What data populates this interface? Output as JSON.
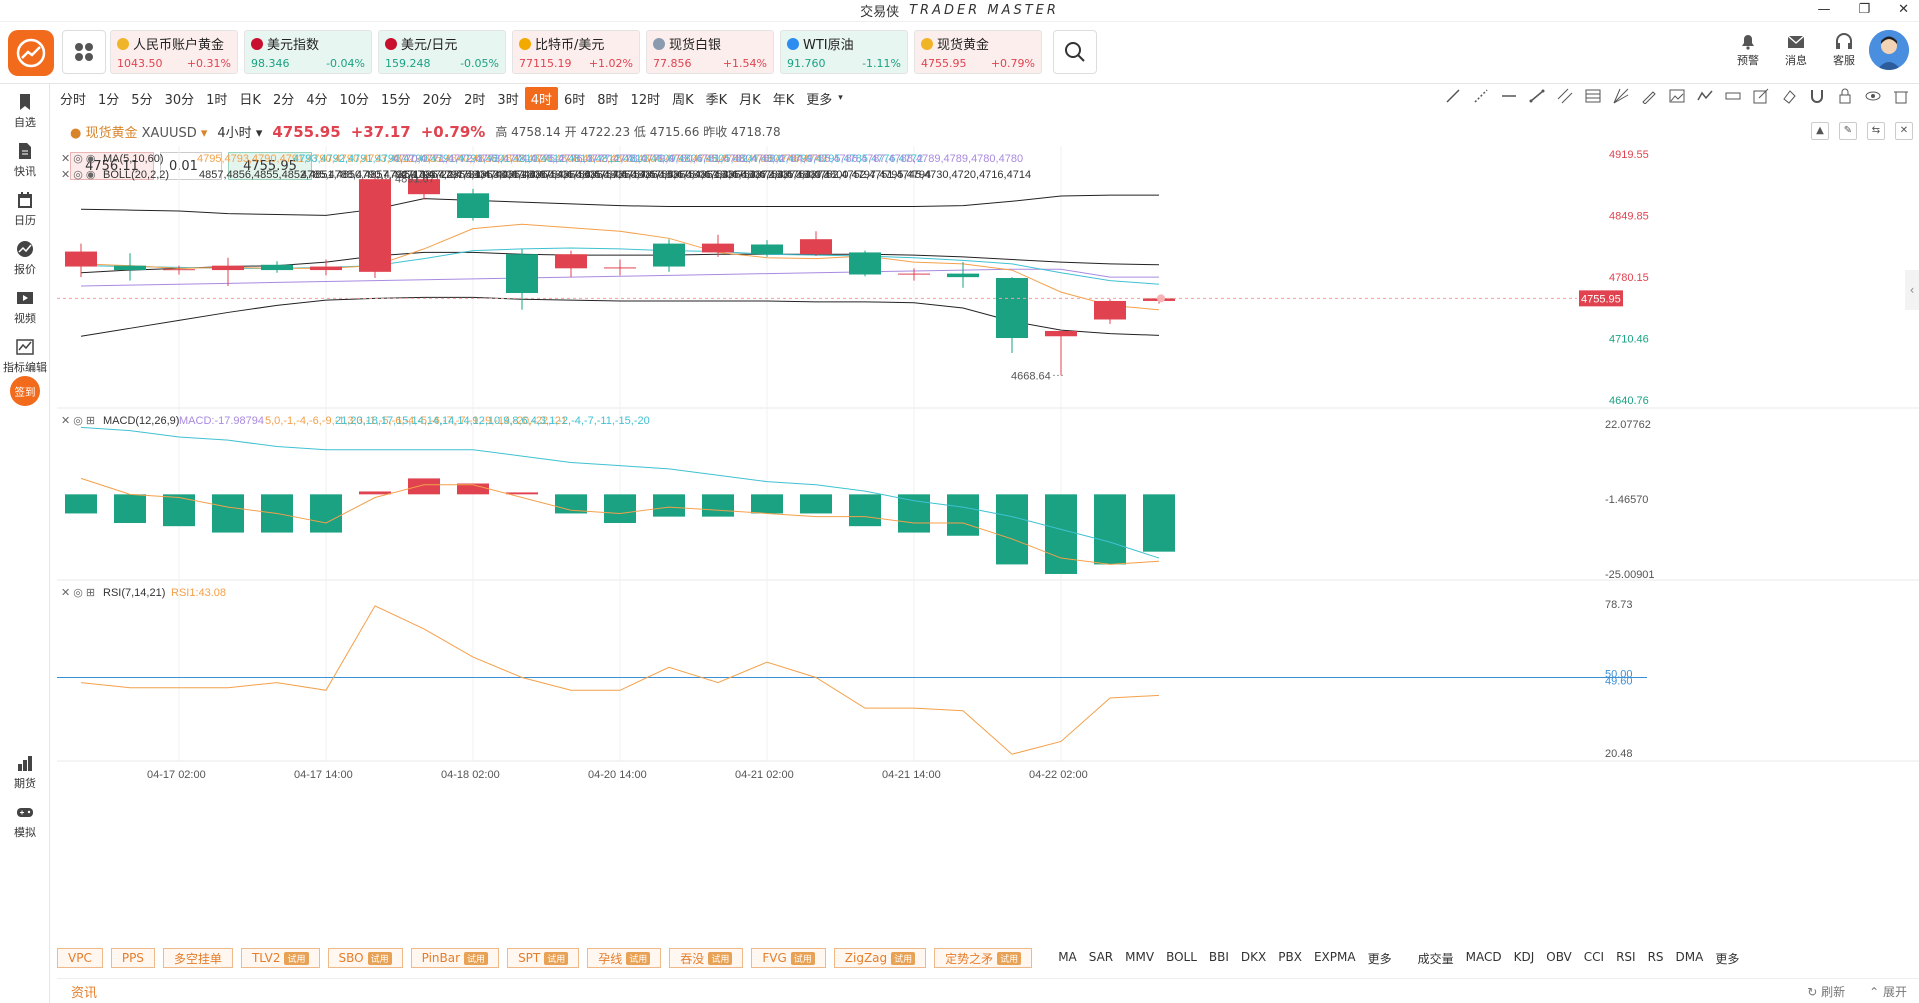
{
  "window": {
    "title_cn": "交易侠",
    "title_en": "TRADER MASTER"
  },
  "tickers": [
    {
      "name": "人民币账户黄金",
      "price": "1043.50",
      "change": "+0.31%",
      "dir": "up",
      "dot": "#f0b429"
    },
    {
      "name": "美元指数",
      "price": "98.346",
      "change": "-0.04%",
      "dir": "down",
      "dot": "#c8102e"
    },
    {
      "name": "美元/日元",
      "price": "159.248",
      "change": "-0.05%",
      "dir": "down",
      "dot": "#c8102e"
    },
    {
      "name": "比特币/美元",
      "price": "77115.19",
      "change": "+1.02%",
      "dir": "up",
      "dot": "#f2a900"
    },
    {
      "name": "现货白银",
      "price": "77.856",
      "change": "+1.54%",
      "dir": "up",
      "dot": "#8a9bb0"
    },
    {
      "name": "WTI原油",
      "price": "91.760",
      "change": "-1.11%",
      "dir": "down",
      "dot": "#2d8cf0"
    },
    {
      "name": "现货黄金",
      "price": "4755.95",
      "change": "+0.79%",
      "dir": "up",
      "dot": "#f0b429"
    }
  ],
  "header_actions": [
    {
      "name": "alert",
      "label": "预警",
      "icon": "bell-icon"
    },
    {
      "name": "message",
      "label": "消息",
      "icon": "mail-icon"
    },
    {
      "name": "service",
      "label": "客服",
      "icon": "headset-icon"
    }
  ],
  "sidebar": [
    {
      "name": "watchlist",
      "label": "自选",
      "icon": "bookmark-icon",
      "top": 0
    },
    {
      "name": "news",
      "label": "快讯",
      "icon": "document-icon",
      "top": 0
    },
    {
      "name": "calendar",
      "label": "日历",
      "icon": "calendar-icon",
      "top": 0
    },
    {
      "name": "quote",
      "label": "报价",
      "icon": "chart-line-icon",
      "top": 0
    },
    {
      "name": "video",
      "label": "视频",
      "icon": "video-icon",
      "top": 0
    },
    {
      "name": "indicator-edit",
      "label": "指标编辑",
      "icon": "indicator-icon",
      "top": 0
    },
    {
      "name": "signin",
      "label": "签到",
      "icon": "signin-badge-icon",
      "top": 0
    },
    {
      "name": "futures",
      "label": "期货",
      "icon": "futures-icon",
      "top": 0
    },
    {
      "name": "simulate",
      "label": "模拟",
      "icon": "gamepad-icon",
      "top": 0
    }
  ],
  "periods": [
    "分时",
    "1分",
    "5分",
    "30分",
    "1时",
    "日K",
    "2分",
    "4分",
    "10分",
    "15分",
    "20分",
    "2时",
    "3时",
    "4时",
    "6时",
    "8时",
    "12时",
    "周K",
    "季K",
    "月K",
    "年K",
    "更多"
  ],
  "active_period": "4时",
  "symbol": {
    "name": "现货黄金",
    "code": "XAUUSD",
    "interval": "4小时",
    "price": "4755.95",
    "change": "+37.17",
    "change_pct": "+0.79%",
    "high_label": "高",
    "high": "4758.14",
    "open_label": "开",
    "open": "4722.23",
    "low_label": "低",
    "low": "4715.66",
    "prev_label": "昨收",
    "prev": "4718.78"
  },
  "order": {
    "ask": "4756.11",
    "qty": "0.01",
    "bid": "4755.95"
  },
  "chart_data": {
    "type": "candlestick",
    "main": {
      "y_ticks": [
        "4919.55",
        "4849.85",
        "4780.15",
        "4710.46",
        "4640.76"
      ],
      "y_min": 4640.76,
      "y_max": 4919.55,
      "last_price": "4755.95",
      "high_mark": "4891.67",
      "low_mark": "4668.64",
      "ma_legend": "MA(5,10,60)",
      "ma5": [
        4795,
        4793,
        4790,
        4791,
        4790,
        4790,
        4793,
        4812,
        4835,
        4840,
        4836,
        4832,
        4824,
        4808,
        4802,
        4801,
        4804,
        4797,
        4795,
        4788,
        4763,
        4748,
        4743
      ],
      "ma10": [
        4793,
        4792,
        4791,
        4790,
        4790,
        4791,
        4793,
        4801,
        4810,
        4812,
        4813,
        4812,
        4810,
        4809,
        4806,
        4805,
        4804,
        4802,
        4799,
        4795,
        4785,
        4776,
        4772
      ],
      "ma60": [
        4770,
        4771,
        4772,
        4773,
        4774,
        4775,
        4776,
        4777,
        4778,
        4779,
        4780,
        4781,
        4782,
        4783,
        4784,
        4785,
        4786,
        4787,
        4788,
        4789,
        4789,
        4780,
        4780
      ],
      "boll_legend": "BOLL(20,2,2)",
      "boll_up": [
        4857,
        4856,
        4855,
        4852,
        4851,
        4850,
        4857,
        4869,
        4867,
        4865,
        4863,
        4861,
        4860,
        4860,
        4860,
        4860,
        4860,
        4860,
        4861,
        4866,
        4872,
        4873,
        4873
      ],
      "boll_mid": [
        4785,
        4788,
        4790,
        4792,
        4793,
        4797,
        4804,
        4808,
        4808,
        4806,
        4805,
        4805,
        4805,
        4806,
        4806,
        4806,
        4806,
        4805,
        4803,
        4800,
        4797,
        4795,
        4794
      ],
      "boll_low": [
        4713,
        4722,
        4731,
        4740,
        4748,
        4754,
        4756,
        4757,
        4757,
        4755,
        4754,
        4753,
        4753,
        4753,
        4753,
        4752,
        4752,
        4751,
        4745,
        4730,
        4720,
        4716,
        4714
      ],
      "candles": [
        {
          "o": 4792,
          "c": 4809,
          "h": 4818,
          "l": 4780
        },
        {
          "o": 4793,
          "c": 4788,
          "h": 4807,
          "l": 4776
        },
        {
          "o": 4788,
          "c": 4789,
          "h": 4793,
          "l": 4783
        },
        {
          "o": 4788,
          "c": 4793,
          "h": 4802,
          "l": 4770
        },
        {
          "o": 4794,
          "c": 4788,
          "h": 4798,
          "l": 4785
        },
        {
          "o": 4788,
          "c": 4792,
          "h": 4800,
          "l": 4782
        },
        {
          "o": 4786,
          "c": 4891,
          "h": 4896,
          "l": 4779
        },
        {
          "o": 4874,
          "c": 4891,
          "h": 4900,
          "l": 4868
        },
        {
          "o": 4875,
          "c": 4847,
          "h": 4880,
          "l": 4844
        },
        {
          "o": 4806,
          "c": 4762,
          "h": 4812,
          "l": 4743
        },
        {
          "o": 4790,
          "c": 4806,
          "h": 4810,
          "l": 4780
        },
        {
          "o": 4790,
          "c": 4791,
          "h": 4800,
          "l": 4782
        },
        {
          "o": 4818,
          "c": 4792,
          "h": 4823,
          "l": 4786
        },
        {
          "o": 4808,
          "c": 4818,
          "h": 4828,
          "l": 4803
        },
        {
          "o": 4817,
          "c": 4806,
          "h": 4822,
          "l": 4803
        },
        {
          "o": 4806,
          "c": 4823,
          "h": 4832,
          "l": 4804
        },
        {
          "o": 4808,
          "c": 4783,
          "h": 4810,
          "l": 4781
        },
        {
          "o": 4783,
          "c": 4784,
          "h": 4790,
          "l": 4776
        },
        {
          "o": 4784,
          "c": 4780,
          "h": 4797,
          "l": 4768
        },
        {
          "o": 4779,
          "c": 4711,
          "h": 4780,
          "l": 4694
        },
        {
          "o": 4713,
          "c": 4719,
          "h": 4720,
          "l": 4668.64
        },
        {
          "o": 4732,
          "c": 4753,
          "h": 4755,
          "l": 4727
        },
        {
          "o": 4753,
          "c": 4756,
          "h": 4758,
          "l": 4750
        }
      ]
    },
    "macd": {
      "legend": "MACD(12,26,9)",
      "macd": "MACD:-17.98794",
      "dif": [
        5,
        0,
        -1,
        -4,
        -6,
        -9,
        -1,
        3,
        3,
        -1,
        -5,
        -6,
        -4,
        -5,
        -6,
        -7,
        -7,
        -9,
        -9,
        -14,
        -20,
        -22,
        -21
      ],
      "dea": [
        21,
        20,
        18,
        17,
        15,
        14,
        14,
        14,
        14,
        12,
        10,
        9,
        8,
        6,
        4,
        3,
        1,
        -2,
        -4,
        -7,
        -11,
        -15,
        -20
      ],
      "y_ticks": [
        "22.07762",
        "-1.46570",
        "-25.00901"
      ],
      "y_min": -25.00901,
      "y_max": 22.07762,
      "hist": [
        -6,
        -9,
        -10,
        -12,
        -12,
        -12,
        0.9,
        5,
        3.4,
        0.6,
        -6,
        -9,
        -7,
        -7,
        -6,
        -6,
        -10,
        -12,
        -13,
        -22,
        -25,
        -22,
        -18
      ]
    },
    "rsi": {
      "legend": "RSI(7,14,21)",
      "rsi": "RSI1:43.08",
      "y_ticks": [
        "78.73",
        "50.00",
        "49.60",
        "20.48"
      ],
      "y_min": 20.48,
      "y_max": 78.73,
      "values": [
        48,
        46,
        46,
        46,
        48,
        45,
        78,
        69,
        58,
        50,
        45,
        45,
        54,
        48,
        56,
        50,
        38,
        38,
        37,
        20,
        25,
        42,
        43
      ]
    },
    "x_labels": [
      {
        "label": "04-17 02:00",
        "i": 2
      },
      {
        "label": "04-17 14:00",
        "i": 5
      },
      {
        "label": "04-18 02:00",
        "i": 8
      },
      {
        "label": "04-20 14:00",
        "i": 11
      },
      {
        "label": "04-21 02:00",
        "i": 14
      },
      {
        "label": "04-21 14:00",
        "i": 17
      },
      {
        "label": "04-22 02:00",
        "i": 20
      }
    ]
  },
  "indicator_tools": [
    {
      "name": "VPC",
      "trial": false
    },
    {
      "name": "PPS",
      "trial": false
    },
    {
      "name": "多空挂单",
      "trial": false
    },
    {
      "name": "TLV2",
      "trial": true
    },
    {
      "name": "SBO",
      "trial": true
    },
    {
      "name": "PinBar",
      "trial": true
    },
    {
      "name": "SPT",
      "trial": true
    },
    {
      "name": "孕线",
      "trial": true
    },
    {
      "name": "吞没",
      "trial": true
    },
    {
      "name": "FVG",
      "trial": true
    },
    {
      "name": "ZigZag",
      "trial": true
    },
    {
      "name": "定势之矛",
      "trial": true
    }
  ],
  "trial_label": "试用",
  "main_indicators": [
    "MA",
    "SAR",
    "MMV",
    "BOLL",
    "BBI",
    "DKX",
    "PBX",
    "EXPMA",
    "更多"
  ],
  "sub_indicators": [
    "成交量",
    "MACD",
    "KDJ",
    "OBV",
    "CCI",
    "RSI",
    "RS",
    "DMA",
    "更多"
  ],
  "info_bar": {
    "label": "资讯",
    "refresh": "刷新",
    "collapse": "展开"
  }
}
